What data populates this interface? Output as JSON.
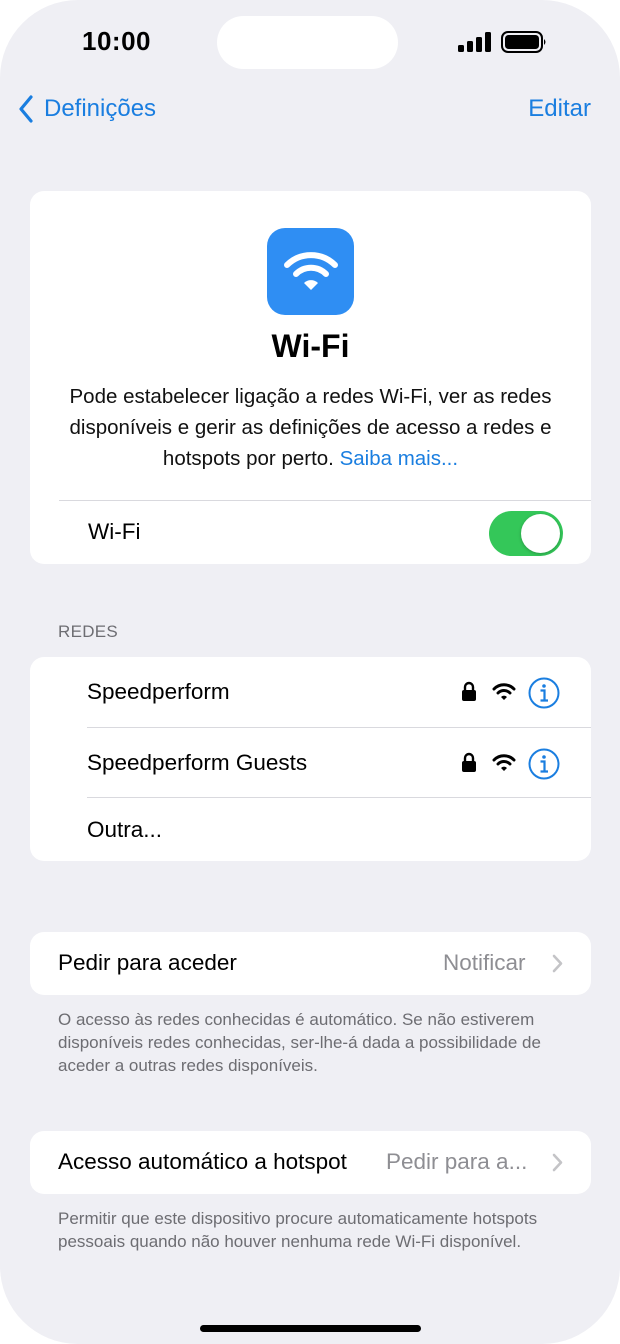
{
  "status_bar": {
    "time": "10:00"
  },
  "nav": {
    "back_label": "Definições",
    "edit_label": "Editar"
  },
  "hero": {
    "title": "Wi-Fi",
    "description": "Pode estabelecer ligação a redes Wi-Fi, ver as redes disponíveis e gerir as definições de acesso a redes e hotspots por perto.",
    "learn_more": "Saiba mais...",
    "toggle_label": "Wi-Fi",
    "toggle_on": true
  },
  "networks": {
    "header": "REDES",
    "items": [
      {
        "name": "Speedperform",
        "secured": true
      },
      {
        "name": "Speedperform Guests",
        "secured": true
      }
    ],
    "other_label": "Outra..."
  },
  "ask_to_join": {
    "label": "Pedir para aceder",
    "value": "Notificar",
    "footnote": "O acesso às redes conhecidas é automático. Se não estiverem disponíveis redes conhecidas, ser-lhe-á dada a possibilidade de aceder a outras redes disponíveis."
  },
  "auto_hotspot": {
    "label": "Acesso automático a hotspot",
    "value": "Pedir para a...",
    "footnote": "Permitir que este dispositivo procure automaticamente hotspots pessoais quando não houver nenhuma rede Wi-Fi disponível."
  },
  "colors": {
    "accent": "#1a7ee0",
    "toggle_on": "#34c759",
    "wifi_icon_bg": "#2f8ef3",
    "background": "#efeff4"
  }
}
